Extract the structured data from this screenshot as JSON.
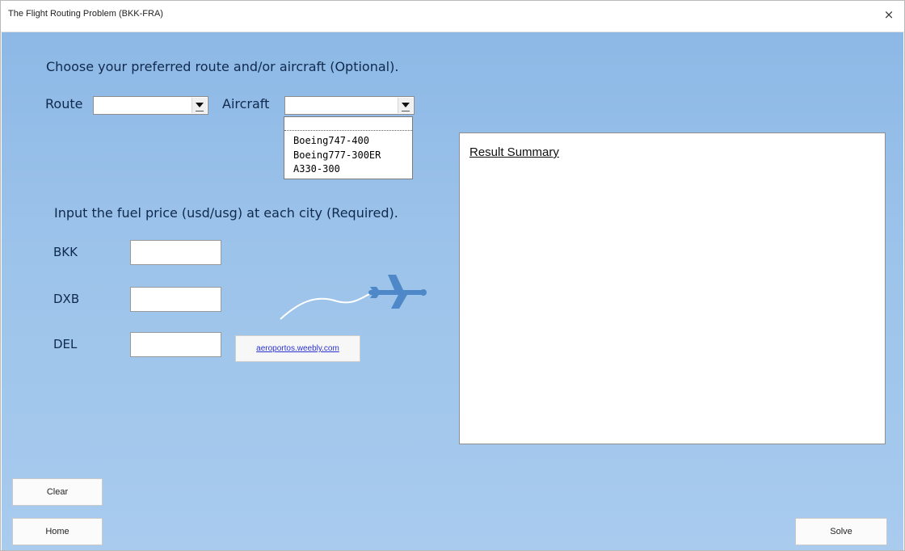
{
  "window": {
    "title": "The Flight Routing Problem (BKK-FRA)",
    "close_symbol": "×"
  },
  "form": {
    "choose_text": "Choose your preferred route and/or aircraft (Optional).",
    "route_label": "Route",
    "route_value": "",
    "aircraft_label": "Aircraft",
    "aircraft_value": "",
    "aircraft_options": [
      "Boeing747-400",
      "Boeing777-300ER",
      "A330-300"
    ],
    "fuel_text": "Input the fuel price (usd/usg) at each city (Required).",
    "cities": [
      {
        "label": "BKK",
        "value": ""
      },
      {
        "label": "DXB",
        "value": ""
      },
      {
        "label": "DEL",
        "value": ""
      }
    ],
    "link_text": "aeroportos.weebly.com",
    "result_title": "Result Summary",
    "buttons": {
      "clear": "Clear",
      "home": "Home",
      "solve": "Solve"
    }
  },
  "colors": {
    "background_blue": "#9cc3ea",
    "plane_blue": "#4f88c9",
    "link_blue": "#2b32d0"
  },
  "icons": {
    "dropdown_arrow": "chevron-down-icon",
    "plane": "airplane-icon"
  }
}
